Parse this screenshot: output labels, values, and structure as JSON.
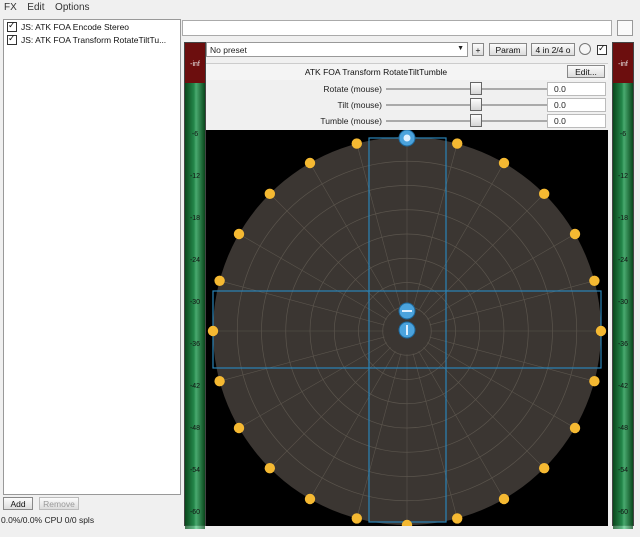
{
  "menu": [
    "FX",
    "Edit",
    "Options"
  ],
  "fx_chain": [
    {
      "name": "JS: ATK FOA Encode Stereo",
      "enabled": true
    },
    {
      "name": "JS: ATK FOA Transform RotateTiltTu...",
      "enabled": true
    }
  ],
  "buttons": {
    "add": "Add",
    "remove": "Remove"
  },
  "status": "0.0%/0.0% CPU 0/0 spls",
  "plugin": {
    "preset": "No preset",
    "plus": "+",
    "param": "Param",
    "io": "4 in 2/4 o",
    "title": "ATK FOA Transform RotateTiltTumble",
    "edit": "Edit...",
    "params": [
      {
        "label": "Rotate (mouse)",
        "value": "0.0",
        "fraction": 0.5
      },
      {
        "label": "Tilt (mouse)",
        "value": "0.0",
        "fraction": 0.5
      },
      {
        "label": "Tumble (mouse)",
        "value": "0.0",
        "fraction": 0.5
      }
    ]
  },
  "meters": {
    "clip_label": "-inf",
    "scale": [
      "0",
      "-6",
      "-12",
      "-18",
      "-24",
      "-30",
      "-36",
      "-42",
      "-48",
      "-54",
      "-60"
    ]
  },
  "colors": {
    "dot": "#f5b932",
    "handle": "#4ba3dd",
    "box": "#2a84b8",
    "sphere": "#3b3632",
    "grid": "#5b554d"
  }
}
